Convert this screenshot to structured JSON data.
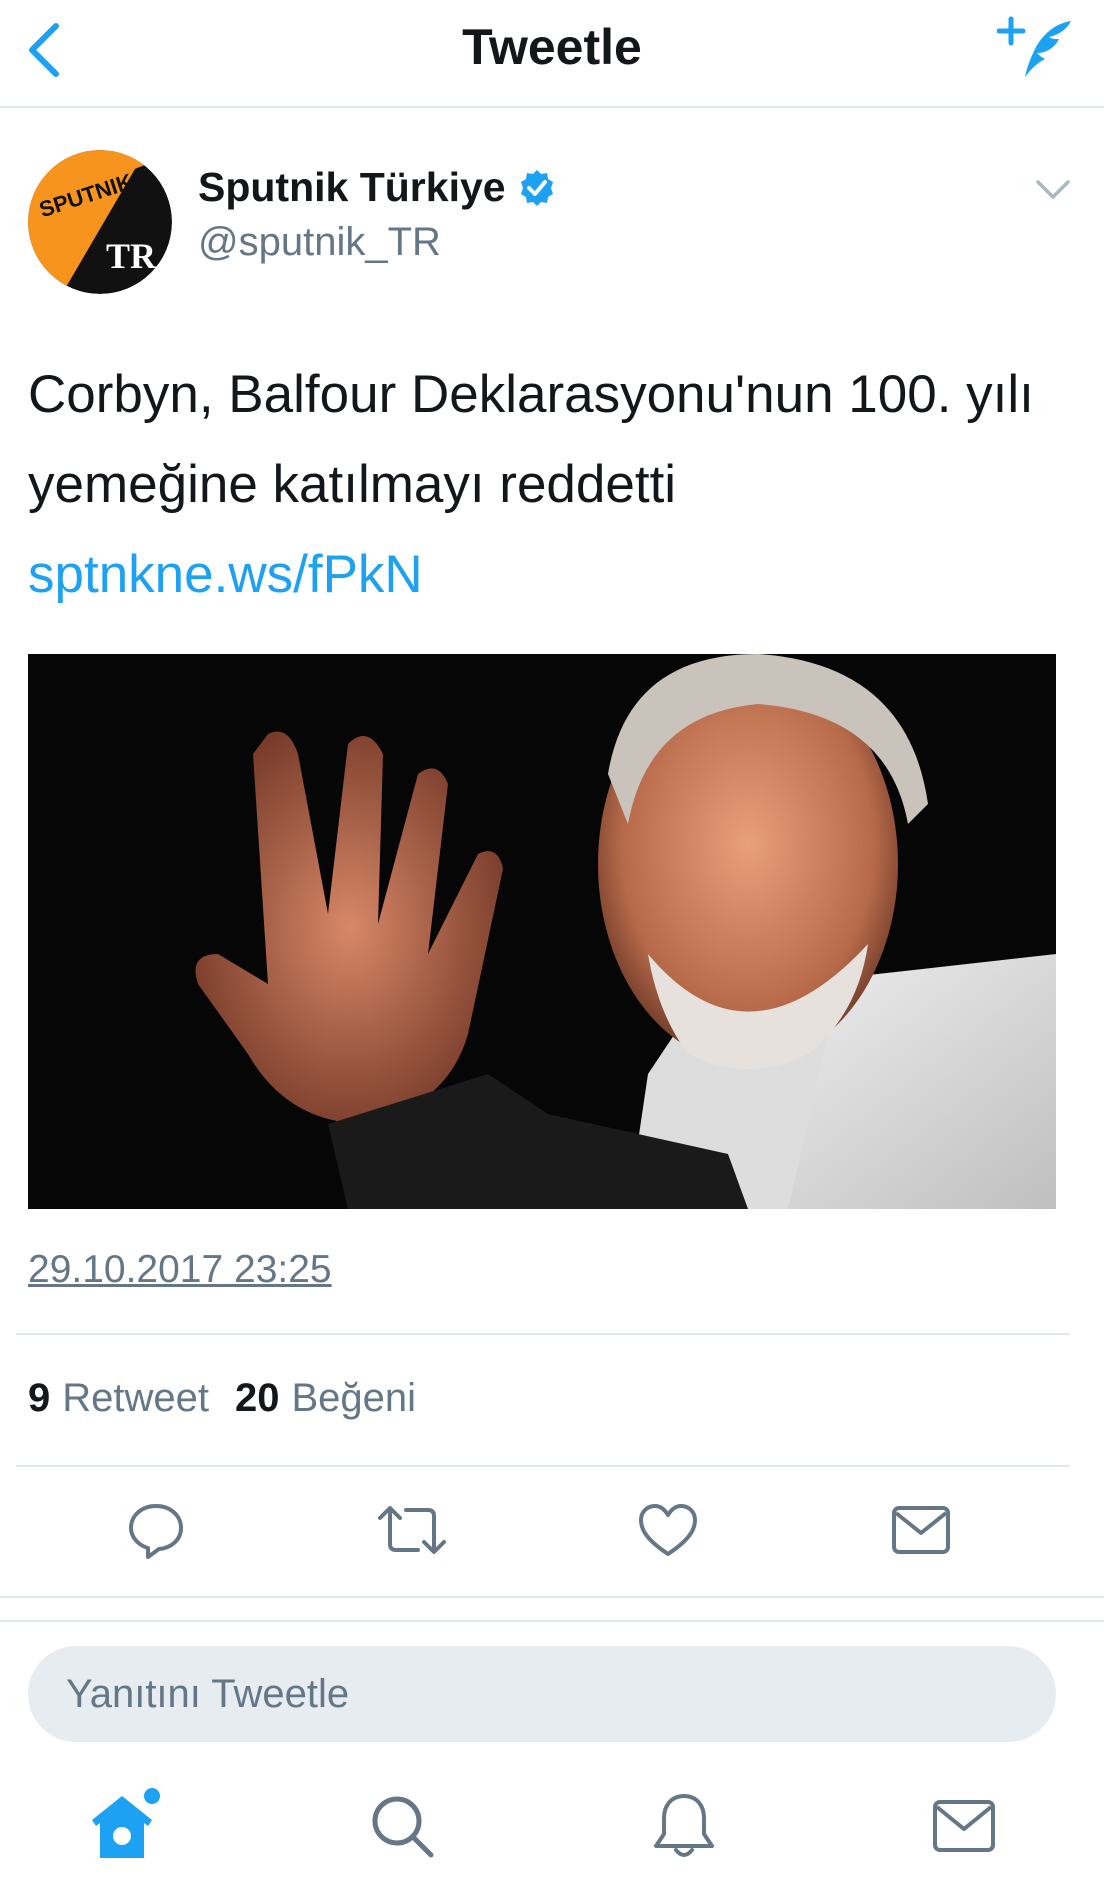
{
  "header": {
    "title": "Tweetle",
    "back_icon": "chevron-left-icon",
    "compose_icon": "compose-tweet-icon",
    "accent_color": "#1da1f2"
  },
  "tweet": {
    "author": {
      "display_name": "Sputnik Türkiye",
      "handle": "@sputnik_TR",
      "verified": true,
      "avatar_text_top": "SPUTNIK",
      "avatar_text_bottom": "TR",
      "avatar_color": "#f7941d"
    },
    "text": "Corbyn, Balfour Deklarasyonu'nun 100. yılı yemeğine katılmayı reddetti",
    "link": "sptnkne.ws/fPkN",
    "timestamp": "29.10.2017 23:25",
    "stats": {
      "retweets": "9",
      "retweets_label": "Retweet",
      "likes": "20",
      "likes_label": "Beğeni"
    }
  },
  "actions": {
    "reply_icon": "reply-icon",
    "retweet_icon": "retweet-icon",
    "like_icon": "heart-icon",
    "dm_icon": "envelope-icon"
  },
  "reply_box": {
    "placeholder": "Yanıtını Tweetle"
  },
  "tabbar": {
    "home_icon": "home-icon",
    "search_icon": "search-icon",
    "notifications_icon": "bell-icon",
    "messages_icon": "envelope-icon"
  }
}
